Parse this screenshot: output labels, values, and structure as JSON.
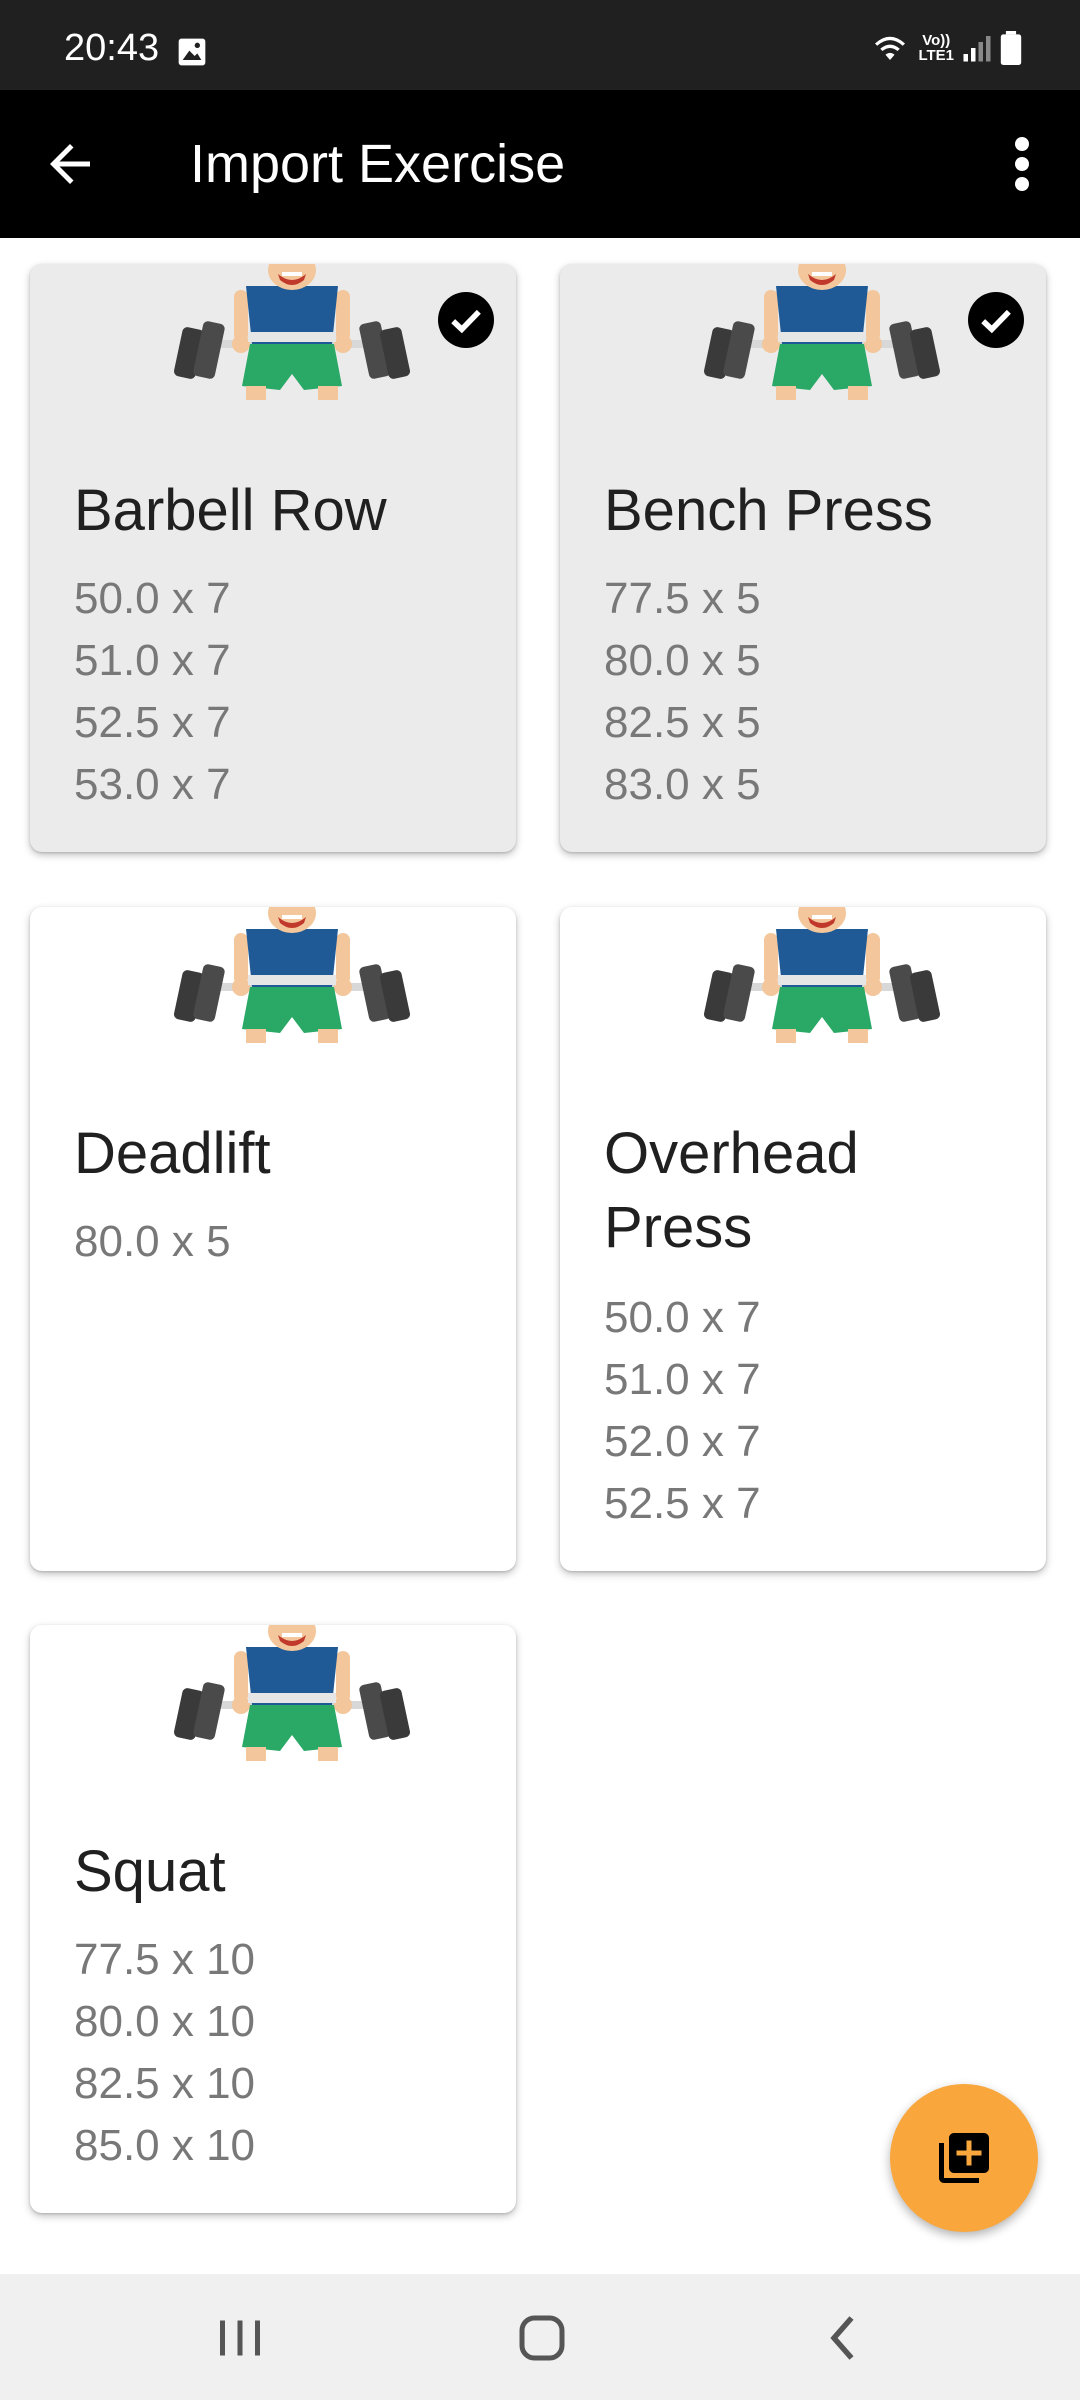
{
  "status_bar": {
    "time": "20:43",
    "icons": [
      "image-icon",
      "wifi-icon",
      "volte-icon",
      "signal-icon",
      "battery-icon"
    ],
    "volte_label_top": "Vo))",
    "volte_label_bottom": "LTE1"
  },
  "app_bar": {
    "title": "Import Exercise",
    "back_icon": "arrow-back-icon",
    "menu_icon": "more-vert-icon"
  },
  "exercises": [
    {
      "name": "Barbell Row",
      "selected": true,
      "sets": [
        "50.0 x 7",
        "51.0 x 7",
        "52.5 x 7",
        "53.0 x 7"
      ]
    },
    {
      "name": "Bench Press",
      "selected": true,
      "sets": [
        "77.5 x 5",
        "80.0 x 5",
        "82.5 x 5",
        "83.0 x 5"
      ]
    },
    {
      "name": "Deadlift",
      "selected": false,
      "sets": [
        "80.0 x 5"
      ]
    },
    {
      "name": "Overhead Press",
      "name_line1": "Overhead",
      "name_line2": "Press",
      "selected": false,
      "sets": [
        "50.0 x 7",
        "51.0 x 7",
        "52.0 x 7",
        "52.5 x 7"
      ]
    },
    {
      "name": "Squat",
      "selected": false,
      "sets": [
        "77.5 x 10",
        "80.0 x 10",
        "82.5 x 10",
        "85.0 x 10"
      ]
    }
  ],
  "fab": {
    "icon": "library-add-icon",
    "color": "#f9a73d"
  },
  "nav_bar": {
    "icons": [
      "recent-apps-icon",
      "home-icon",
      "back-icon"
    ]
  },
  "colors": {
    "selected_card": "#ebebeb",
    "app_bar": "#000000",
    "status_bar": "#202020",
    "set_text": "#787878"
  }
}
